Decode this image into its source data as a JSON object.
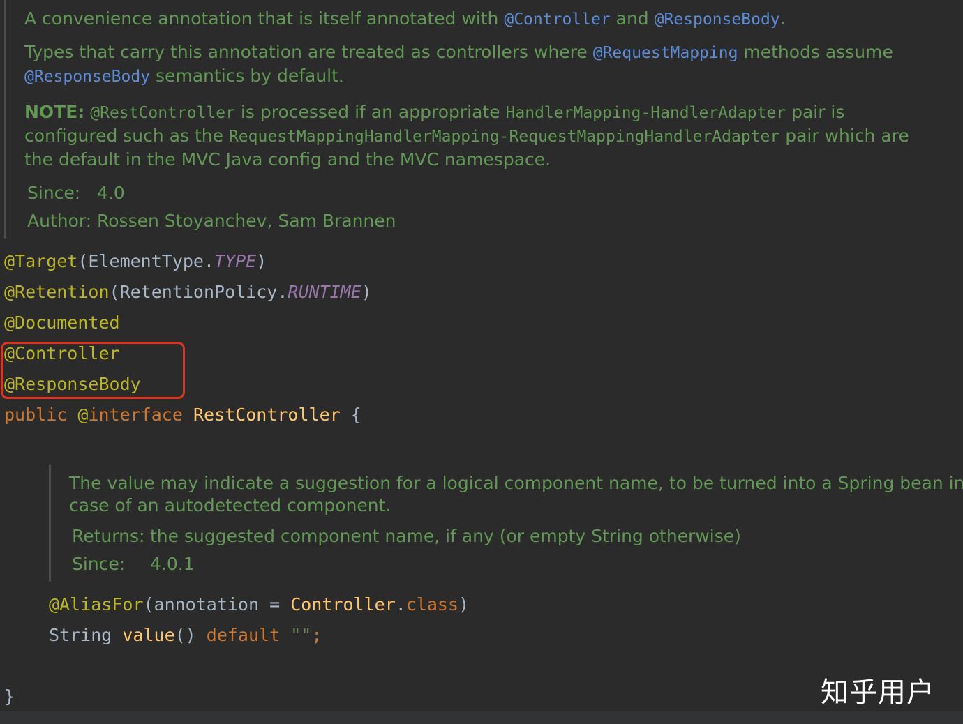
{
  "doc1": {
    "l1": {
      "t1": "A convenience annotation that is itself annotated with ",
      "c1": "@Controller",
      "t2": " and ",
      "c2": "@ResponseBody",
      "t3": "."
    },
    "l2": {
      "t1": "Types that carry this annotation are treated as controllers where ",
      "c1": "@RequestMapping",
      "t2": " methods assume"
    },
    "l3": {
      "c1": "@ResponseBody",
      "t1": " semantics by default."
    },
    "l4": {
      "b": "NOTE:",
      "c1": "@RestController",
      "t1": " is processed if an appropriate ",
      "c2": "HandlerMapping-HandlerAdapter",
      "t2": " pair is"
    },
    "l5": {
      "t1": "configured such as the ",
      "c1": "RequestMappingHandlerMapping-RequestMappingHandlerAdapter",
      "t2": " pair which are"
    },
    "l6": {
      "t1": "the default in the MVC Java config and the MVC namespace."
    },
    "since": {
      "label": "Since:",
      "value": "4.0"
    },
    "author": {
      "label": "Author:",
      "value": "Rossen Stoyanchev, Sam Brannen"
    }
  },
  "code": {
    "target": {
      "ann": "@Target",
      "open": "(ElementType.",
      "val": "TYPE",
      "close": ")"
    },
    "retention": {
      "ann": "@Retention",
      "open": "(RetentionPolicy.",
      "val": "RUNTIME",
      "close": ")"
    },
    "documented": "@Documented",
    "controller": "@Controller",
    "response_body": "@ResponseBody",
    "decl": {
      "kw1": "public",
      "at": "@",
      "kw2": "interface",
      "name": "RestController",
      "brace": "{"
    },
    "alias": {
      "ann": "@AliasFor",
      "p1": "(annotation = ",
      "cls": "Controller",
      "dot": ".",
      "kw": "class",
      "p2": ")"
    },
    "method": {
      "type": "String ",
      "name": "value",
      "paren": "() ",
      "kw": "default",
      "str": "\"\"",
      "semi": ";"
    },
    "close_brace": "}"
  },
  "doc2": {
    "l1": "The value may indicate a suggestion for a logical component name, to be turned into a Spring bean in",
    "l2": "case of an autodetected component.",
    "returns": {
      "label": "Returns:",
      "value": "the suggested component name, if any (or empty String otherwise)"
    },
    "since": {
      "label": "Since:",
      "value": "4.0.1"
    }
  },
  "watermark": "知乎用户",
  "colors": {
    "background": "#2b2b2b",
    "doc": "#629755",
    "link": "#5d8bd6",
    "annotation": "#bbb529",
    "keyword": "#cc7832",
    "highlight": "#e0321d"
  }
}
